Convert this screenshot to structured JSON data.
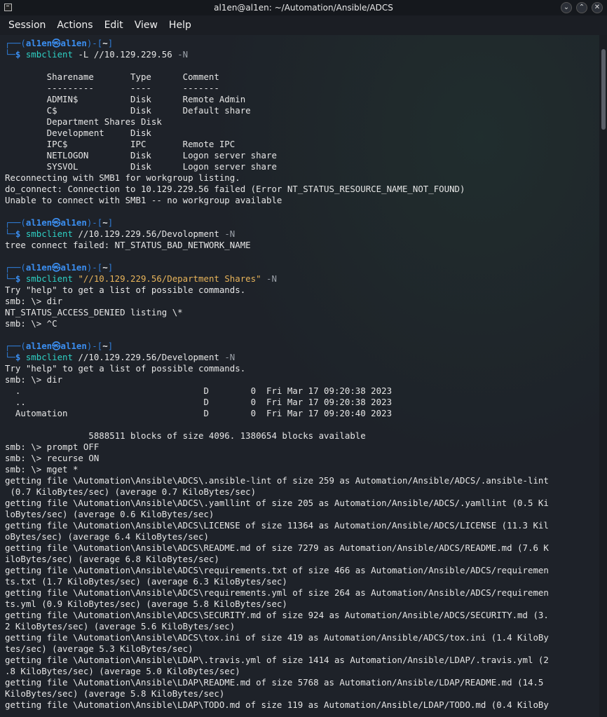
{
  "window": {
    "title": "al1en@al1en: ~/Automation/Ansible/ADCS",
    "buttons": [
      "⌄",
      "⌃",
      "✕"
    ]
  },
  "menu": [
    "Session",
    "Actions",
    "Edit",
    "View",
    "Help"
  ],
  "prompt": {
    "open": "┌──(",
    "user": "al1en㉿al1en",
    "mid": ")-[",
    "path": "~",
    "close": "]",
    "prefix": "└─",
    "dollar": "$ "
  },
  "blocks": [
    {
      "cmd": "smbclient",
      "args": [
        {
          "t": "arg",
          "v": " -L //10.129.229.56 "
        },
        {
          "t": "flag",
          "v": "-N"
        }
      ]
    },
    {
      "cmd": "smbclient",
      "args": [
        {
          "t": "arg",
          "v": " //10.129.229.56/Devolopment "
        },
        {
          "t": "flag",
          "v": "-N"
        }
      ]
    },
    {
      "cmd": "smbclient",
      "args": [
        {
          "t": "str",
          "v": " \"//10.129.229.56/Department Shares\" "
        },
        {
          "t": "flag",
          "v": "-N"
        }
      ]
    },
    {
      "cmd": "smbclient",
      "args": [
        {
          "t": "arg",
          "v": " //10.129.229.56/Development "
        },
        {
          "t": "flag",
          "v": "-N"
        }
      ]
    }
  ],
  "output1": [
    "",
    "        Sharename       Type      Comment",
    "        ---------       ----      -------",
    "        ADMIN$          Disk      Remote Admin",
    "        C$              Disk      Default share",
    "        Department Shares Disk",
    "        Development     Disk",
    "        IPC$            IPC       Remote IPC",
    "        NETLOGON        Disk      Logon server share",
    "        SYSVOL          Disk      Logon server share",
    "Reconnecting with SMB1 for workgroup listing.",
    "do_connect: Connection to 10.129.229.56 failed (Error NT_STATUS_RESOURCE_NAME_NOT_FOUND)",
    "Unable to connect with SMB1 -- no workgroup available",
    ""
  ],
  "output2": [
    "tree connect failed: NT_STATUS_BAD_NETWORK_NAME",
    ""
  ],
  "output3": [
    "Try \"help\" to get a list of possible commands.",
    "smb: \\> dir",
    "NT_STATUS_ACCESS_DENIED listing \\*",
    "smb: \\> ^C",
    ""
  ],
  "output4": [
    "Try \"help\" to get a list of possible commands.",
    "smb: \\> dir",
    "  .                                   D        0  Fri Mar 17 09:20:38 2023",
    "  ..                                  D        0  Fri Mar 17 09:20:38 2023",
    "  Automation                          D        0  Fri Mar 17 09:20:40 2023",
    "",
    "                5888511 blocks of size 4096. 1380654 blocks available",
    "smb: \\> prompt OFF",
    "smb: \\> recurse ON",
    "smb: \\> mget *",
    "getting file \\Automation\\Ansible\\ADCS\\.ansible-lint of size 259 as Automation/Ansible/ADCS/.ansible-lint",
    " (0.7 KiloBytes/sec) (average 0.7 KiloBytes/sec)",
    "getting file \\Automation\\Ansible\\ADCS\\.yamllint of size 205 as Automation/Ansible/ADCS/.yamllint (0.5 Ki",
    "loBytes/sec) (average 0.6 KiloBytes/sec)",
    "getting file \\Automation\\Ansible\\ADCS\\LICENSE of size 11364 as Automation/Ansible/ADCS/LICENSE (11.3 Kil",
    "oBytes/sec) (average 6.4 KiloBytes/sec)",
    "getting file \\Automation\\Ansible\\ADCS\\README.md of size 7279 as Automation/Ansible/ADCS/README.md (7.6 K",
    "iloBytes/sec) (average 6.8 KiloBytes/sec)",
    "getting file \\Automation\\Ansible\\ADCS\\requirements.txt of size 466 as Automation/Ansible/ADCS/requiremen",
    "ts.txt (1.7 KiloBytes/sec) (average 6.3 KiloBytes/sec)",
    "getting file \\Automation\\Ansible\\ADCS\\requirements.yml of size 264 as Automation/Ansible/ADCS/requiremen",
    "ts.yml (0.9 KiloBytes/sec) (average 5.8 KiloBytes/sec)",
    "getting file \\Automation\\Ansible\\ADCS\\SECURITY.md of size 924 as Automation/Ansible/ADCS/SECURITY.md (3.",
    "2 KiloBytes/sec) (average 5.6 KiloBytes/sec)",
    "getting file \\Automation\\Ansible\\ADCS\\tox.ini of size 419 as Automation/Ansible/ADCS/tox.ini (1.4 KiloBy",
    "tes/sec) (average 5.3 KiloBytes/sec)",
    "getting file \\Automation\\Ansible\\LDAP\\.travis.yml of size 1414 as Automation/Ansible/LDAP/.travis.yml (2",
    ".8 KiloBytes/sec) (average 5.0 KiloBytes/sec)",
    "getting file \\Automation\\Ansible\\LDAP\\README.md of size 5768 as Automation/Ansible/LDAP/README.md (14.5",
    "KiloBytes/sec) (average 5.8 KiloBytes/sec)",
    "getting file \\Automation\\Ansible\\LDAP\\TODO.md of size 119 as Automation/Ansible/LDAP/TODO.md (0.4 KiloBy"
  ]
}
